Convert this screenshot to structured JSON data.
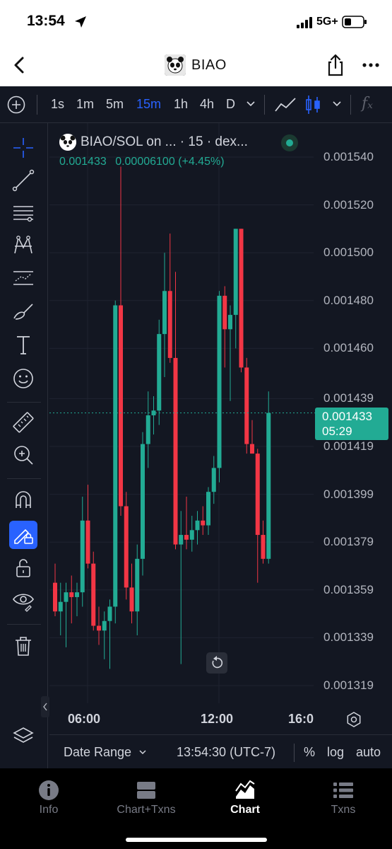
{
  "status_bar": {
    "time": "13:54",
    "network": "5G+"
  },
  "header": {
    "title": "BIAO"
  },
  "toolbar": {
    "intervals": [
      "1s",
      "1m",
      "5m",
      "15m",
      "1h",
      "4h",
      "D"
    ],
    "active_interval": "15m",
    "fx_label": "fₓ"
  },
  "legend": {
    "symbol": "BIAO/SOL on ... · 15 · dex...",
    "last_price": "0.001433",
    "change": "0.00006100 (+4.45%)"
  },
  "price_tag": {
    "value": "0.001433",
    "countdown": "05:29"
  },
  "bottom_bar": {
    "date_range": "Date Range",
    "time": "13:54:30 (UTC-7)",
    "percent": "%",
    "log": "log",
    "auto": "auto"
  },
  "tabs": [
    {
      "label": "Info",
      "icon": "info-icon"
    },
    {
      "label": "Chart+Txns",
      "icon": "split-icon"
    },
    {
      "label": "Chart",
      "icon": "chart-icon",
      "active": true
    },
    {
      "label": "Txns",
      "icon": "list-icon"
    }
  ],
  "colors": {
    "up": "#22ab94",
    "down": "#f23645",
    "accent": "#2962ff",
    "background": "#131722"
  },
  "chart_data": {
    "type": "candlestick",
    "y_axis_ticks": [
      "0.001540",
      "0.001520",
      "0.001500",
      "0.001480",
      "0.001460",
      "0.001439",
      "0.001419",
      "0.001399",
      "0.001379",
      "0.001359",
      "0.001339",
      "0.001319"
    ],
    "ylim": [
      0.00131,
      0.00155
    ],
    "x_axis_ticks": [
      "06:00",
      "12:00",
      "16:0"
    ],
    "current_price": 0.001433,
    "candles": [
      {
        "o": 0.001362,
        "h": 0.00137,
        "l": 0.001348,
        "c": 0.00135
      },
      {
        "o": 0.00135,
        "h": 0.001362,
        "l": 0.00134,
        "c": 0.001354
      },
      {
        "o": 0.001354,
        "h": 0.001362,
        "l": 0.001335,
        "c": 0.001358
      },
      {
        "o": 0.001358,
        "h": 0.001365,
        "l": 0.001345,
        "c": 0.001356
      },
      {
        "o": 0.001356,
        "h": 0.001362,
        "l": 0.001348,
        "c": 0.001358
      },
      {
        "o": 0.001358,
        "h": 0.001398,
        "l": 0.001352,
        "c": 0.001388
      },
      {
        "o": 0.001388,
        "h": 0.001403,
        "l": 0.001368,
        "c": 0.00137
      },
      {
        "o": 0.00137,
        "h": 0.001375,
        "l": 0.001342,
        "c": 0.001344
      },
      {
        "o": 0.001344,
        "h": 0.001352,
        "l": 0.001336,
        "c": 0.001342
      },
      {
        "o": 0.001342,
        "h": 0.00135,
        "l": 0.00133,
        "c": 0.001346
      },
      {
        "o": 0.001346,
        "h": 0.001355,
        "l": 0.001326,
        "c": 0.001352
      },
      {
        "o": 0.001352,
        "h": 0.00148,
        "l": 0.001345,
        "c": 0.001478
      },
      {
        "o": 0.001478,
        "h": 0.001536,
        "l": 0.00139,
        "c": 0.001394
      },
      {
        "o": 0.001394,
        "h": 0.0014,
        "l": 0.001355,
        "c": 0.00136
      },
      {
        "o": 0.00136,
        "h": 0.00137,
        "l": 0.001345,
        "c": 0.00135
      },
      {
        "o": 0.00135,
        "h": 0.001378,
        "l": 0.00134,
        "c": 0.001372
      },
      {
        "o": 0.001372,
        "h": 0.001425,
        "l": 0.001365,
        "c": 0.00142
      },
      {
        "o": 0.00142,
        "h": 0.001442,
        "l": 0.00141,
        "c": 0.001432
      },
      {
        "o": 0.001432,
        "h": 0.00144,
        "l": 0.001424,
        "c": 0.001434
      },
      {
        "o": 0.001434,
        "h": 0.001472,
        "l": 0.001428,
        "c": 0.001466
      },
      {
        "o": 0.001466,
        "h": 0.0015,
        "l": 0.001448,
        "c": 0.001484
      },
      {
        "o": 0.001484,
        "h": 0.001508,
        "l": 0.001454,
        "c": 0.001456
      },
      {
        "o": 0.001456,
        "h": 0.001492,
        "l": 0.001376,
        "c": 0.001378
      },
      {
        "o": 0.001378,
        "h": 0.001392,
        "l": 0.001328,
        "c": 0.001382
      },
      {
        "o": 0.001382,
        "h": 0.001398,
        "l": 0.001376,
        "c": 0.00138
      },
      {
        "o": 0.00138,
        "h": 0.00139,
        "l": 0.001375,
        "c": 0.001384
      },
      {
        "o": 0.001384,
        "h": 0.001392,
        "l": 0.001378,
        "c": 0.001388
      },
      {
        "o": 0.001388,
        "h": 0.001394,
        "l": 0.001382,
        "c": 0.001386
      },
      {
        "o": 0.001386,
        "h": 0.001402,
        "l": 0.001382,
        "c": 0.0014
      },
      {
        "o": 0.0014,
        "h": 0.001415,
        "l": 0.001395,
        "c": 0.00141
      },
      {
        "o": 0.00141,
        "h": 0.001484,
        "l": 0.001404,
        "c": 0.001482
      },
      {
        "o": 0.001482,
        "h": 0.001486,
        "l": 0.001452,
        "c": 0.001468
      },
      {
        "o": 0.001468,
        "h": 0.001478,
        "l": 0.001438,
        "c": 0.001474
      },
      {
        "o": 0.001474,
        "h": 0.00151,
        "l": 0.00146,
        "c": 0.00151
      },
      {
        "o": 0.00151,
        "h": 0.00151,
        "l": 0.00145,
        "c": 0.001452
      },
      {
        "o": 0.001452,
        "h": 0.001456,
        "l": 0.001416,
        "c": 0.00142
      },
      {
        "o": 0.00142,
        "h": 0.00143,
        "l": 0.001416,
        "c": 0.001416
      },
      {
        "o": 0.001416,
        "h": 0.001418,
        "l": 0.001362,
        "c": 0.001382
      },
      {
        "o": 0.001382,
        "h": 0.001388,
        "l": 0.00137,
        "c": 0.001372
      },
      {
        "o": 0.001372,
        "h": 0.001442,
        "l": 0.00137,
        "c": 0.001433
      }
    ]
  }
}
